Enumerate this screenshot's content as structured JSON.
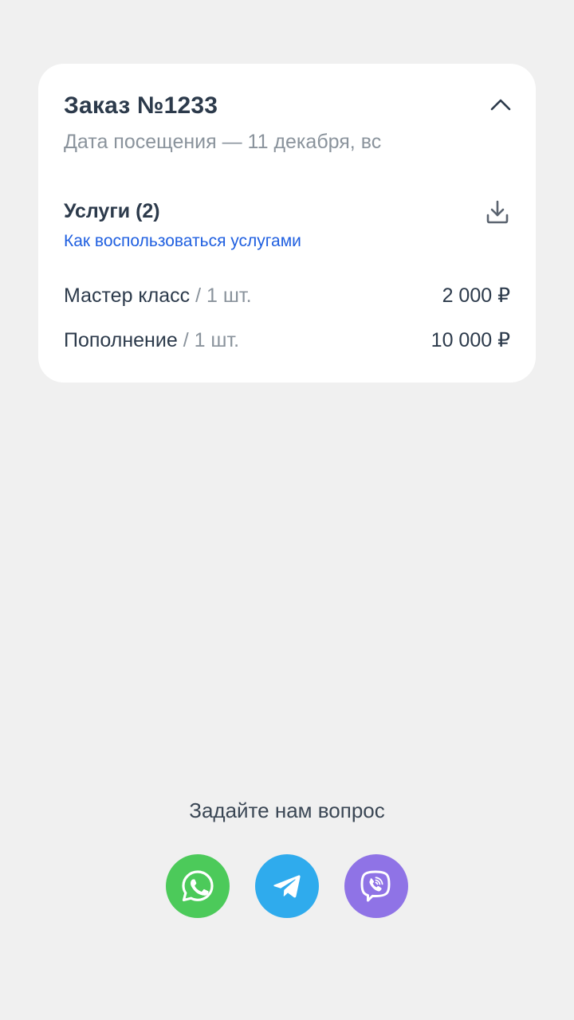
{
  "order": {
    "title": "Заказ №1233",
    "visit_date": "Дата посещения — 11 декабря, вс",
    "collapse_icon": "chevron-up-icon"
  },
  "services": {
    "title": "Услуги (2)",
    "download_icon": "download-icon",
    "howto_link": "Как воспользоваться услугами",
    "items": [
      {
        "name": "Мастер класс",
        "qty": " / 1 шт.",
        "price": "2 000 ₽"
      },
      {
        "name": "Пополнение",
        "qty": " / 1 шт.",
        "price": "10 000 ₽"
      }
    ]
  },
  "contact": {
    "prompt": "Задайте нам вопрос",
    "messengers": [
      {
        "name": "whatsapp",
        "icon": "whatsapp-icon",
        "color": "#4cca5a"
      },
      {
        "name": "telegram",
        "icon": "telegram-icon",
        "color": "#2fabed"
      },
      {
        "name": "viber",
        "icon": "viber-icon",
        "color": "#8f73e6"
      }
    ]
  }
}
